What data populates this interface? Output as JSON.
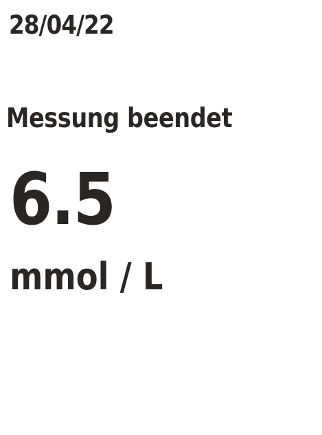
{
  "screen": {
    "date": "28/04/22",
    "status": "Messung beendet",
    "value": "6.5",
    "unit": "mmol / L"
  },
  "colors": {
    "background": "#ffffff",
    "text": "#2a2624"
  }
}
